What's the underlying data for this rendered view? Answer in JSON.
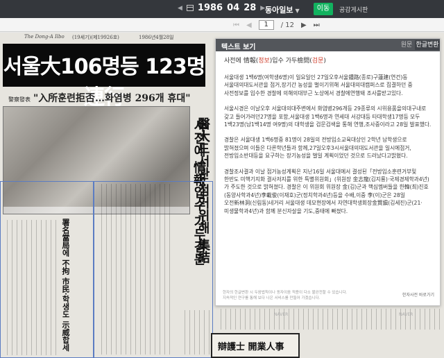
{
  "topbar": {
    "year": "1986",
    "month": "04",
    "day": "28",
    "month_unit": "월",
    "day_unit": "일",
    "newspaper": "동아일보",
    "go_label": "이동",
    "notice_label": "공감게시판"
  },
  "pager": {
    "current_page": "1",
    "total_pages": "/ 12"
  },
  "scan": {
    "masthead_title": "The Dong-A Ilbo",
    "masthead_issue": "(19세기)(제19926호)",
    "masthead_date": "1986년4월28일",
    "headline": "서울大106명등 123명 連行",
    "subhead_tag": "警察發表",
    "subhead": "\"入所훈련拒否…화염병 296개 휴대\"",
    "vertical_title_1": "醫大도서관 점거위해 集結",
    "vertical_title_2": "사전에 情報입수 가두검문",
    "mid_vertical_title": "署名當局에 不拘 市民·학생도 示威합세",
    "bottom_box": "辯護士 開業人事",
    "watermark": "NAVER"
  },
  "panel": {
    "title": "텍스트 보기",
    "tab_original": "원문",
    "tab_hangul": "한글변환",
    "headline_a": "사전에 情報(",
    "headline_a_red": "정보",
    "headline_b": ")입수 가두檢問(",
    "headline_b_red": "검문",
    "headline_c": ")",
    "paragraphs": [
      "서울대생 1백6명(여학생6명)이 일요일인 27일오후서울鍾路(종로)구蓮建(연건)동 서울대의대도서관을 점거,장기간 농성을 벌이기위해 서울대의대캠퍼스로 집결하던 중 사전정보를 입수한 경찰에 의해의대부근 노상에서 경찰에연행돼 조사를받고있다.",
      "서울시경은 이날오후 서울대의대주변에서 화염병296개등 29종류의 시위용품을의대구내로 갖고 들어가려던27명을 포함,서울대생 1백6명과 연세대 서강대등 타대학생17명등 모두 1백23명(남1백14명 여9명)의 대학생을 검문검색을 통해 연행,조사중이라고 28일 발표했다.",
      "경찰은 서울대생 1백6명중 81명이 28일의 전방입소교육대상인 2학년 남학생으로 밝혀졌으며 이들은 다른학년들과 함께,27일오후3시서울대의대도서관을 일시에점거,전방입소반대등을 요구하는 장기농성을 벌일 계획이었던 것으로 드러났다고밝혔다.",
      "경찰조사결과 이날 점거농성계획은 지난16일 서울대에서 결성된「전방입소훈련거부및 한반도 미핵기지화 결사저지를 위한 특별위원회」(위원장 金志龍(김지룡)·국제경제학과4년)가 주도한 것으로 밝혀졌다. 경찰은 이 위원회 위원장 金(김)군과 핵심멤버들을 한韓(최)진호(동양사학과4년)李載俊(이재호)군(정치학과4년)등을 수배,이중 李(이)군은 28일 오전新林洞(신림동)네거리 서울대생 데모현장에서 자연대학생회장金賢鎭(김세진)군(21·미생물학과4년)과 함께 분신자살을 기도,중태에 빠졌다."
    ],
    "footer_line1": "한자의 한글변환 시 두음법칙이나 동자이음 적용이 다소 불완전할 수 있습니다.",
    "footer_line2": "지속적인 연구를 통해 보다 나은 서비스를 만들어 가겠습니다.",
    "footer_right": "한자사전 바로가기"
  },
  "colors": {
    "topbar_bg": "#34373c",
    "go_button": "#12b25f",
    "highlight_red": "#d0412f",
    "frame_blue": "#5b7cc2"
  }
}
